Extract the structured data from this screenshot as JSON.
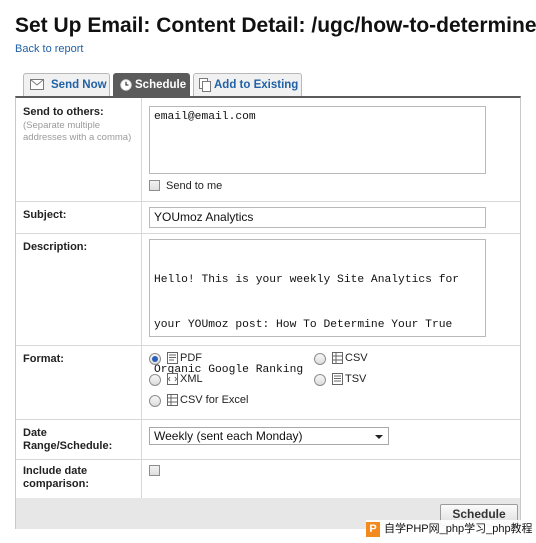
{
  "page": {
    "title": "Set Up Email: Content Detail: /ugc/how-to-determine-your-true-organic-google-ranking",
    "back_link": "Back to report"
  },
  "tabs": [
    {
      "label": "Send Now",
      "icon": "envelope-icon",
      "active": false
    },
    {
      "label": "Schedule",
      "icon": "clock-icon",
      "active": true
    },
    {
      "label": "Add to Existing",
      "icon": "documents-icon",
      "active": false
    }
  ],
  "form": {
    "send_to": {
      "label": "Send to others:",
      "hint": "(Separate multiple addresses with a comma)",
      "value": "email@email.com",
      "send_to_me_label": "Send to me",
      "send_to_me_checked": false
    },
    "subject": {
      "label": "Subject:",
      "value": "YOUmoz Analytics"
    },
    "description": {
      "label": "Description:",
      "value_line1": "Hello! This is your weekly Site Analytics for",
      "value_line2": "your YOUmoz post: How To Determine Your True",
      "value_line3": "Organic Google Ranking"
    },
    "format": {
      "label": "Format:",
      "selected": "PDF",
      "options": [
        {
          "label": "PDF",
          "icon": "pdf-icon",
          "checked": true
        },
        {
          "label": "CSV",
          "icon": "csv-icon",
          "checked": false
        },
        {
          "label": "XML",
          "icon": "xml-icon",
          "checked": false
        },
        {
          "label": "TSV",
          "icon": "tsv-icon",
          "checked": false
        },
        {
          "label": "CSV for Excel",
          "icon": "excel-csv-icon",
          "checked": false
        }
      ]
    },
    "date_range": {
      "label": "Date Range/Schedule:",
      "selected": "Weekly (sent each Monday)"
    },
    "include_comparison": {
      "label": "Include date comparison:",
      "checked": false
    }
  },
  "actions": {
    "schedule_label": "Schedule"
  },
  "watermark": {
    "logo_letter": "P",
    "text": "自学PHP网_php学习_php教程"
  },
  "colors": {
    "link": "#2161a6",
    "active_tab": "#5b5b5b",
    "footer": "#e7e7e7",
    "watermark_logo": "#f28a1d"
  }
}
